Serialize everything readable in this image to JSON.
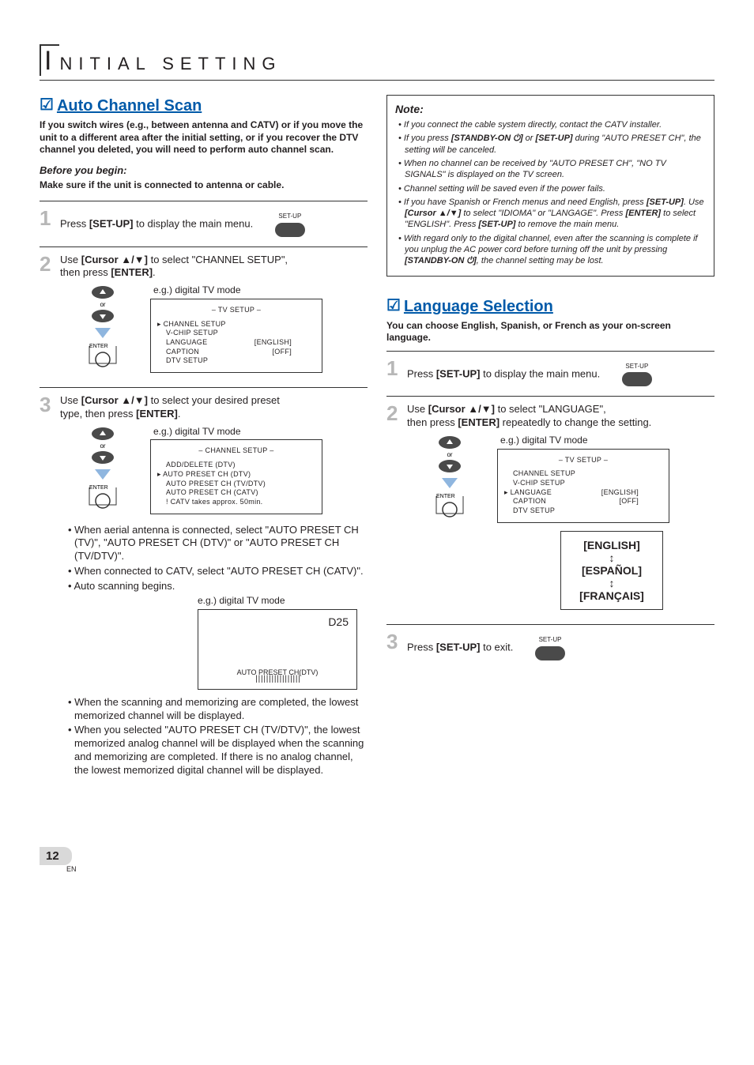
{
  "header": {
    "title_first_letter": "I",
    "title_rest": "NITIAL  SETTING"
  },
  "left": {
    "feature_check": "☑",
    "feature_title": "Auto Channel Scan",
    "intro": "If you switch wires (e.g., between antenna and CATV) or if you move the unit to a different area after the initial setting, or if you recover the DTV channel you deleted, you will need to perform auto channel scan.",
    "before_label": "Before you begin:",
    "before_text": "Make sure if the unit is connected to antenna or cable.",
    "step1": {
      "num": "1",
      "pre": "Press ",
      "btn": "[SET-UP]",
      "post": " to display the main menu.",
      "remote_label": "SET-UP"
    },
    "step2": {
      "num": "2",
      "pre": "Use ",
      "btn": "[Cursor ▲/▼]",
      "post1": " to select \"CHANNEL SETUP\",",
      "post2": "then press ",
      "btn2": "[ENTER]",
      "post3": ".",
      "eg": "e.g.) digital TV mode",
      "menu_title": "–  TV SETUP  –",
      "menu_line1": "CHANNEL SETUP",
      "menu_line2": "V-CHIP  SETUP",
      "menu_line3a": "LANGUAGE",
      "menu_line3b": "[ENGLISH]",
      "menu_line4a": "CAPTION",
      "menu_line4b": "[OFF]",
      "menu_line5": "DTV SETUP",
      "or": "or",
      "enter": "ENTER"
    },
    "step3": {
      "num": "3",
      "pre": "Use ",
      "btn": "[Cursor ▲/▼]",
      "post1": " to select your desired preset",
      "post2": "type, then press ",
      "btn2": "[ENTER]",
      "post3": ".",
      "eg": "e.g.) digital TV mode",
      "menu_title": "–  CHANNEL SETUP  –",
      "menu_line1": "ADD/DELETE (DTV)",
      "menu_line2": "AUTO PRESET CH (DTV)",
      "menu_line3": "AUTO PRESET CH (TV/DTV)",
      "menu_line4": "AUTO PRESET CH (CATV)",
      "menu_line5": "! CATV takes approx. 50min.",
      "bullet1": "• When aerial antenna is connected, select \"AUTO PRESET CH (TV)\", \"AUTO PRESET CH (DTV)\" or \"AUTO PRESET CH (TV/DTV)\".",
      "bullet2": "• When connected to CATV, select \"AUTO PRESET CH (CATV)\".",
      "bullet3": "• Auto scanning begins.",
      "eg2": "e.g.) digital TV mode",
      "d25": "D25",
      "scan_label": "AUTO PRESET CH(DTV)",
      "scan_bar": "| | |  | | | | | | | |  |  |  | | | |",
      "bullet4": "• When the scanning and memorizing are completed, the lowest memorized channel will be displayed.",
      "bullet5": "• When you selected \"AUTO PRESET CH (TV/DTV)\", the lowest memorized analog channel will be displayed when the scanning and memorizing are completed. If there is no analog channel, the lowest memorized digital channel will be displayed."
    }
  },
  "right": {
    "note_title": "Note:",
    "note1a": "• If you connect the cable system directly, contact the CATV installer.",
    "note2a": "• If you press ",
    "note2b": "[STANDBY-ON ⏻]",
    "note2c": " or ",
    "note2d": "[SET-UP]",
    "note2e": " during \"AUTO PRESET CH\", the setting will be canceled.",
    "note3": "• When no channel can be received by \"AUTO PRESET CH\", \"NO TV SIGNALS\" is displayed on the TV screen.",
    "note4": "• Channel setting will be saved even if the power fails.",
    "note5a": "• If you have Spanish or French menus and need English, press ",
    "note5b": "[SET-UP]",
    "note5c": ". Use ",
    "note5d": "[Cursor ▲/▼]",
    "note5e": " to select \"IDIOMA\" or \"LANGAGE\". Press ",
    "note5f": "[ENTER]",
    "note5g": " to select \"ENGLISH\". Press ",
    "note5h": "[SET-UP]",
    "note5i": " to remove the main menu.",
    "note6a": "• With regard only to the digital channel, even after the scanning is complete if you unplug the AC power cord before turning off the unit by pressing ",
    "note6b": "[STANDBY-ON ⏻]",
    "note6c": ", the channel setting may be lost.",
    "feature_check": "☑",
    "feature_title": "Language Selection",
    "intro": "You can choose English, Spanish, or French as your on-screen language.",
    "step1": {
      "num": "1",
      "pre": "Press ",
      "btn": "[SET-UP]",
      "post": " to display the main menu.",
      "remote_label": "SET-UP"
    },
    "step2": {
      "num": "2",
      "pre": "Use ",
      "btn": "[Cursor ▲/▼]",
      "post1": " to select \"LANGUAGE\",",
      "post2": "then press ",
      "btn2": "[ENTER]",
      "post3": " repeatedly to change the setting.",
      "eg": "e.g.) digital TV mode",
      "menu_title": "–  TV SETUP  –",
      "menu_line1": "CHANNEL SETUP",
      "menu_line2": "V-CHIP  SETUP",
      "menu_line3a": "LANGUAGE",
      "menu_line3b": "[ENGLISH]",
      "menu_line4a": "CAPTION",
      "menu_line4b": "[OFF]",
      "menu_line5": "DTV SETUP",
      "lang1": "[ENGLISH]",
      "lang2": "[ESPAÑOL]",
      "lang3": "[FRANÇAIS]"
    },
    "step3": {
      "num": "3",
      "pre": "Press ",
      "btn": "[SET-UP]",
      "post": " to exit.",
      "remote_label": "SET-UP"
    }
  },
  "footer": {
    "page": "12",
    "en": "EN"
  }
}
